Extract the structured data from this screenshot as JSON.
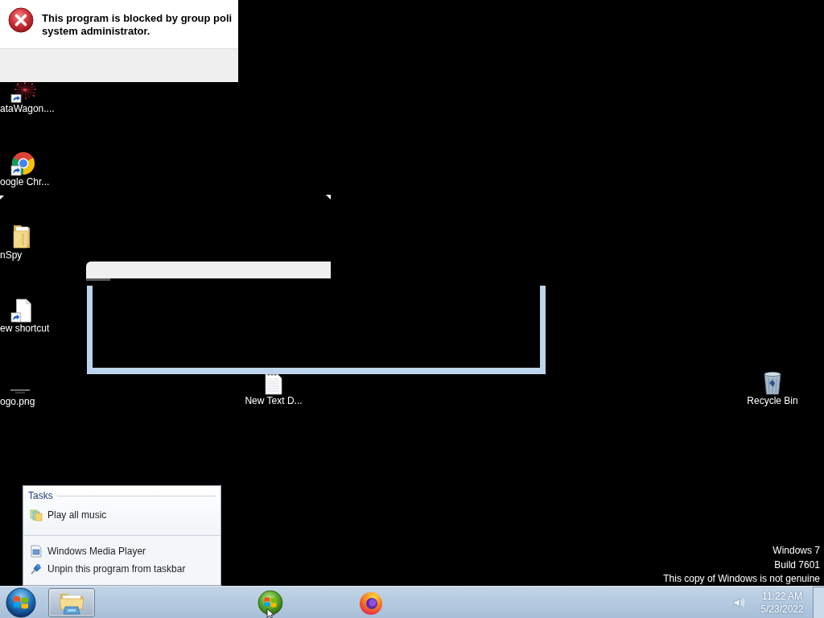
{
  "error_dialog": {
    "message_lines": [
      "This program is blocked by group poli",
      "system administrator."
    ]
  },
  "desktop_icons": [
    {
      "label": "ataWagon....",
      "kind": "starburst",
      "shortcut": true
    },
    {
      "label": "oogle Chr...",
      "kind": "chrome",
      "shortcut": true
    },
    {
      "label": "nSpy",
      "kind": "folder",
      "shortcut": false
    },
    {
      "label": "ew shortcut",
      "kind": "blank_page",
      "shortcut": true
    },
    {
      "label": "ogo.png",
      "kind": "image",
      "shortcut": false
    },
    {
      "label": "New Text D...",
      "kind": "text_file",
      "shortcut": false
    },
    {
      "label": "Recycle Bin",
      "kind": "recycle_bin",
      "shortcut": false
    }
  ],
  "jump_list": {
    "tasks_title": "Tasks",
    "tasks": [
      {
        "label": "Play all music",
        "kind": "music"
      }
    ],
    "items": [
      {
        "label": "Windows Media Player",
        "kind": "program"
      },
      {
        "label": "Unpin this program from taskbar",
        "kind": "unpin"
      }
    ]
  },
  "os_notice": [
    "Windows 7",
    "Build 7601",
    "This copy of Windows is not genuine"
  ],
  "taskbar": {
    "buttons": [
      {
        "kind": "explorer",
        "running": true
      },
      {
        "kind": "media_player",
        "running": false
      },
      {
        "kind": "firefox",
        "running": false
      }
    ],
    "clock": {
      "time": "11:22 AM",
      "date": "5/23/2022"
    }
  }
}
